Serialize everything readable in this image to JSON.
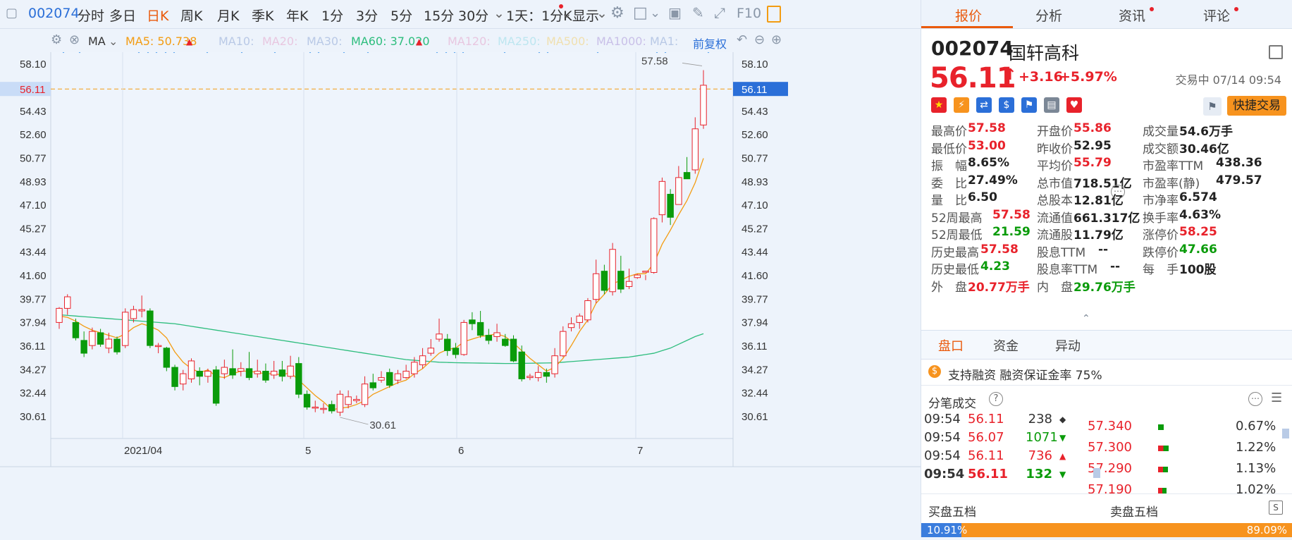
{
  "toolbar": {
    "code": "002074",
    "items": [
      "分时",
      "多日",
      "日K",
      "周K",
      "月K",
      "季K",
      "年K",
      "1分",
      "3分",
      "5分",
      "15分",
      "30分"
    ],
    "active": "日K",
    "interval_label": "1天：1分K",
    "display_label": "显示",
    "f10_label": "F10"
  },
  "ma_bar": {
    "ma_label": "MA",
    "ma5": "MA5: 50.738",
    "ma10": "MA10:",
    "ma20": "MA20:",
    "ma30": "MA30:",
    "ma60": "MA60: 37.020",
    "ma120": "MA120:",
    "ma250": "MA250:",
    "ma500": "MA500:",
    "ma1000": "MA1000:",
    "ma1": "MA1:",
    "adjust": "前复权",
    "colors": {
      "ma5": "#f39c12",
      "ma60": "#2dbd7d",
      "faded": "#b9c9e6"
    }
  },
  "chart_data": {
    "type": "candlestick",
    "y_ticks": [
      "58.10",
      "56.11",
      "54.43",
      "52.60",
      "50.77",
      "48.93",
      "47.10",
      "45.27",
      "43.44",
      "41.60",
      "39.77",
      "37.94",
      "36.11",
      "34.27",
      "32.44",
      "30.61"
    ],
    "ylim": [
      29.5,
      59.5
    ],
    "x_labels": [
      "2021/04",
      "5",
      "6",
      "7"
    ],
    "current_price_label": "56.11",
    "max_label": "57.58",
    "min_label": "30.61",
    "up_color": "#e8222b",
    "down_color": "#0a9b0a",
    "ma5_color": "#f39c12",
    "ma60_color": "#2dbd7d",
    "candles": [
      [
        37.9,
        39.0,
        39.1,
        37.4
      ],
      [
        39.0,
        39.9,
        40.1,
        38.5
      ],
      [
        37.9,
        36.7,
        38.2,
        36.5
      ],
      [
        36.5,
        35.5,
        37.2,
        35.2
      ],
      [
        36.1,
        37.2,
        37.5,
        35.8
      ],
      [
        37.1,
        36.2,
        37.4,
        36.0
      ],
      [
        35.9,
        36.6,
        37.1,
        35.5
      ],
      [
        36.6,
        35.6,
        36.8,
        35.4
      ],
      [
        36.1,
        38.7,
        39.0,
        35.9
      ],
      [
        38.2,
        38.9,
        39.2,
        37.9
      ],
      [
        38.8,
        38.9,
        40.0,
        38.3
      ],
      [
        38.8,
        36.1,
        39.0,
        35.9
      ],
      [
        36.1,
        36.1,
        36.3,
        35.5
      ],
      [
        35.9,
        34.4,
        36.0,
        34.1
      ],
      [
        34.4,
        32.9,
        34.6,
        32.6
      ],
      [
        33.1,
        33.9,
        34.2,
        32.6
      ],
      [
        33.5,
        34.9,
        35.1,
        33.2
      ],
      [
        34.1,
        33.7,
        34.4,
        33.0
      ],
      [
        33.7,
        34.1,
        34.3,
        33.2
      ],
      [
        34.2,
        31.6,
        34.5,
        31.4
      ],
      [
        33.9,
        34.4,
        35.0,
        33.5
      ],
      [
        34.3,
        33.8,
        35.8,
        33.5
      ],
      [
        34.1,
        34.3,
        34.8,
        33.7
      ],
      [
        34.3,
        33.6,
        35.6,
        33.4
      ],
      [
        33.9,
        34.1,
        35.0,
        33.6
      ],
      [
        34.1,
        33.4,
        34.7,
        33.2
      ],
      [
        33.8,
        34.1,
        34.9,
        33.5
      ],
      [
        34.2,
        33.7,
        34.9,
        33.3
      ],
      [
        33.7,
        34.5,
        35.3,
        33.5
      ],
      [
        34.7,
        32.3,
        35.2,
        32.0
      ],
      [
        32.3,
        31.3,
        32.6,
        31.1
      ],
      [
        31.3,
        31.3,
        31.8,
        30.9
      ],
      [
        31.2,
        31.2,
        31.6,
        30.8
      ],
      [
        31.5,
        31.0,
        31.8,
        30.8
      ],
      [
        30.9,
        32.3,
        32.6,
        30.6
      ],
      [
        31.5,
        32.1,
        32.6,
        31.2
      ],
      [
        31.8,
        31.9,
        32.2,
        31.6
      ],
      [
        31.5,
        33.1,
        33.7,
        31.3
      ],
      [
        33.2,
        32.8,
        33.9,
        32.6
      ],
      [
        33.4,
        33.6,
        34.1,
        33.2
      ],
      [
        34.0,
        33.0,
        34.3,
        32.8
      ],
      [
        33.4,
        33.9,
        34.2,
        33.1
      ],
      [
        33.6,
        34.1,
        34.6,
        33.5
      ],
      [
        33.9,
        34.8,
        35.2,
        33.6
      ],
      [
        34.6,
        35.3,
        35.9,
        34.3
      ],
      [
        35.5,
        35.9,
        36.6,
        35.3
      ],
      [
        36.6,
        37.0,
        38.2,
        36.4
      ],
      [
        36.6,
        35.7,
        37.0,
        35.3
      ],
      [
        35.9,
        35.4,
        36.3,
        35.1
      ],
      [
        35.4,
        37.9,
        38.1,
        35.3
      ],
      [
        38.1,
        37.8,
        38.7,
        37.3
      ],
      [
        37.9,
        36.9,
        38.8,
        36.7
      ],
      [
        36.9,
        36.5,
        37.4,
        36.2
      ],
      [
        36.8,
        37.1,
        37.8,
        36.4
      ],
      [
        36.6,
        36.1,
        37.0,
        36.0
      ],
      [
        36.6,
        34.9,
        36.9,
        34.8
      ],
      [
        35.6,
        33.5,
        36.1,
        33.3
      ],
      [
        33.6,
        33.7,
        33.9,
        33.4
      ],
      [
        33.6,
        34.0,
        34.5,
        33.3
      ],
      [
        34.0,
        33.7,
        34.3,
        33.2
      ],
      [
        33.9,
        35.3,
        35.9,
        33.6
      ],
      [
        35.3,
        37.2,
        37.6,
        35.2
      ],
      [
        37.5,
        37.8,
        38.3,
        37.2
      ],
      [
        37.9,
        38.4,
        38.6,
        37.4
      ],
      [
        38.1,
        39.6,
        39.8,
        37.9
      ],
      [
        39.7,
        41.7,
        42.8,
        39.4
      ],
      [
        41.9,
        40.4,
        42.4,
        40.1
      ],
      [
        40.3,
        43.6,
        44.1,
        40.0
      ],
      [
        41.9,
        40.5,
        43.1,
        40.2
      ],
      [
        40.7,
        41.1,
        42.1,
        40.5
      ],
      [
        41.4,
        41.6,
        41.7,
        41.3
      ],
      [
        41.9,
        41.9,
        41.6,
        41.2
      ],
      [
        41.8,
        46.0,
        46.1,
        41.7
      ],
      [
        46.3,
        48.9,
        49.2,
        45.7
      ],
      [
        47.9,
        46.1,
        48.3,
        45.5
      ],
      [
        47.1,
        49.2,
        50.1,
        47.4
      ],
      [
        49.6,
        49.1,
        50.8,
        49.1
      ],
      [
        49.8,
        53.0,
        53.9,
        49.5
      ],
      [
        53.3,
        56.4,
        57.58,
        53.0
      ]
    ],
    "ma5": [
      38.4,
      38.3,
      38.0,
      37.6,
      37.3,
      37.1,
      36.9,
      36.7,
      37.0,
      37.5,
      37.8,
      37.6,
      37.3,
      36.7,
      35.6,
      34.8,
      34.3,
      34.0,
      34.2,
      33.7,
      33.6,
      33.9,
      34.1,
      34.1,
      34.0,
      33.9,
      33.9,
      33.8,
      34.0,
      33.4,
      32.8,
      32.2,
      31.7,
      31.1,
      31.2,
      31.3,
      31.5,
      31.8,
      32.3,
      32.6,
      32.9,
      33.2,
      33.4,
      33.9,
      34.3,
      34.9,
      35.5,
      35.8,
      35.9,
      36.4,
      36.6,
      36.8,
      36.9,
      37.0,
      36.8,
      36.3,
      35.7,
      35.1,
      34.6,
      34.1,
      34.4,
      35.1,
      36.1,
      37.2,
      38.1,
      39.4,
      40.1,
      40.9,
      41.2,
      41.5,
      41.7,
      41.7,
      42.5,
      44.0,
      45.1,
      46.3,
      47.4,
      48.8,
      50.7
    ],
    "ma60": [
      38.5,
      38.45,
      38.4,
      38.35,
      38.3,
      38.25,
      38.2,
      38.15,
      38.1,
      38.05,
      38.0,
      37.95,
      37.9,
      37.85,
      37.8,
      37.7,
      37.6,
      37.5,
      37.4,
      37.3,
      37.2,
      37.1,
      37.0,
      36.9,
      36.8,
      36.7,
      36.6,
      36.5,
      36.4,
      36.3,
      36.2,
      36.1,
      36.0,
      35.9,
      35.8,
      35.7,
      35.6,
      35.5,
      35.4,
      35.3,
      35.2,
      35.1,
      35.0,
      34.95,
      34.9,
      34.85,
      34.8,
      34.78,
      34.76,
      34.75,
      34.74,
      34.73,
      34.72,
      34.71,
      34.7,
      34.7,
      34.71,
      34.72,
      34.73,
      34.74,
      34.75,
      34.8,
      34.85,
      34.9,
      34.95,
      35.0,
      35.05,
      35.1,
      35.15,
      35.2,
      35.3,
      35.4,
      35.5,
      35.7,
      35.9,
      36.2,
      36.5,
      36.8,
      37.02
    ]
  },
  "right_panel": {
    "tabs": [
      "报价",
      "分析",
      "资讯",
      "评论"
    ],
    "active_tab": "报价",
    "code": "002074",
    "name": "国轩高科",
    "price": "56.11",
    "change": "+3.16",
    "change_pct": "+5.97%",
    "trade_status": "交易中 07/14 09:54",
    "quick_trade": "快捷交易",
    "stats_col1": [
      {
        "label": "最高价",
        "value": "57.58",
        "color": "red"
      },
      {
        "label": "最低价",
        "value": "53.00",
        "color": "red"
      },
      {
        "label": "振　幅",
        "value": "8.65%",
        "color": "dark"
      },
      {
        "label": "委　比",
        "value": "27.49%",
        "color": "dark"
      },
      {
        "label": "量　比",
        "value": "6.50",
        "color": "dark"
      },
      {
        "label": "52周最高",
        "value": "57.58",
        "color": "red"
      },
      {
        "label": "52周最低",
        "value": "21.59",
        "color": "green"
      },
      {
        "label": "历史最高",
        "value": "57.58",
        "color": "red"
      },
      {
        "label": "历史最低",
        "value": "4.23",
        "color": "green"
      },
      {
        "label": "外　盘",
        "value": "20.77万手",
        "color": "red"
      }
    ],
    "stats_col2": [
      {
        "label": "开盘价",
        "value": "55.86",
        "color": "red"
      },
      {
        "label": "昨收价",
        "value": "52.95",
        "color": "dark"
      },
      {
        "label": "平均价",
        "value": "55.79",
        "color": "red"
      },
      {
        "label": "总市值",
        "value": "718.51亿",
        "color": "dark"
      },
      {
        "label": "总股本",
        "value": "12.81亿",
        "color": "dark"
      },
      {
        "label": "流通值",
        "value": "661.317亿",
        "color": "dark"
      },
      {
        "label": "流通股",
        "value": "11.79亿",
        "color": "dark"
      },
      {
        "label": "股息TTM",
        "value": "--",
        "color": "dark"
      },
      {
        "label": "股息率TTM",
        "value": "--",
        "color": "dark"
      },
      {
        "label": "内　盘",
        "value": "29.76万手",
        "color": "green"
      }
    ],
    "stats_col3": [
      {
        "label": "成交量",
        "value": "54.6万手",
        "color": "dark"
      },
      {
        "label": "成交额",
        "value": "30.46亿",
        "color": "dark"
      },
      {
        "label": "市盈率TTM",
        "value": "438.36",
        "color": "dark"
      },
      {
        "label": "市盈率(静)",
        "value": "479.57",
        "color": "dark"
      },
      {
        "label": "市净率",
        "value": "6.574",
        "color": "dark"
      },
      {
        "label": "换手率",
        "value": "4.63%",
        "color": "dark"
      },
      {
        "label": "涨停价",
        "value": "58.25",
        "color": "red"
      },
      {
        "label": "跌停价",
        "value": "47.66",
        "color": "green"
      },
      {
        "label": "每　手",
        "value": "100股",
        "color": "dark"
      }
    ],
    "sub_tabs": [
      "盘口",
      "资金",
      "异动"
    ],
    "margin_text": "支持融资  融资保证金率 75%",
    "deals_title": "分笔成交",
    "deals": [
      {
        "time": "09:54",
        "price": "56.11",
        "vol": "238",
        "dir": "◆"
      },
      {
        "time": "09:54",
        "price": "56.07",
        "vol": "1071",
        "dir": "▼"
      },
      {
        "time": "09:54",
        "price": "56.11",
        "vol": "736",
        "dir": "▲"
      },
      {
        "time": "09:54",
        "price": "56.11",
        "vol": "132",
        "dir": "▼"
      }
    ],
    "levels": [
      {
        "price": "57.340",
        "pct": "0.67%",
        "fill": 0.67
      },
      {
        "price": "57.300",
        "pct": "1.22%",
        "fill": 1.22
      },
      {
        "price": "57.290",
        "pct": "1.13%",
        "fill": 1.13
      },
      {
        "price": "57.190",
        "pct": "1.02%",
        "fill": 1.02
      }
    ],
    "buy_label": "买盘五档",
    "sell_label": "卖盘五档",
    "buy_pct": "10.91%",
    "sell_pct": "89.09%",
    "buy_fraction": 0.1091
  }
}
